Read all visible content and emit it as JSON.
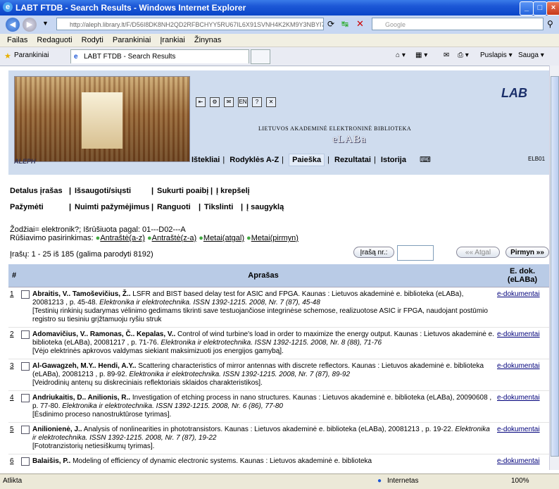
{
  "window": {
    "title": "LABT FTDB - Search Results - Windows Internet Explorer"
  },
  "address": {
    "url": "http://aleph.library.lt/F/D56I8DK8NH2QD2RFBCHYY5RU67IL6X91SVNH4K2KM9Y3NBYI7",
    "search_placeholder": "Google"
  },
  "menu": [
    "Failas",
    "Redaguoti",
    "Rodyti",
    "Parankiniai",
    "Įrankiai",
    "Žinynas"
  ],
  "tabbar": {
    "favorites": "Parankiniai",
    "tab_title": "LABT FTDB - Search Results",
    "page_label": "Puslapis",
    "safety_label": "Sauga"
  },
  "header": {
    "aleph": "ALEPH",
    "library_name": "LIETUVOS AKADEMINĖ ELEKTRONINĖ BIBLIOTEKA",
    "elaba": "eLABa",
    "logo": "LAB",
    "code": "ELB01",
    "nav": [
      "Ištekliai",
      "Rodyklės A-Z",
      "Paieška",
      "Rezultatai",
      "Istorija"
    ]
  },
  "actions": {
    "row1": [
      "Detalus įrašas",
      "Išsaugoti/siųsti",
      "Sukurti poaibį",
      "Į krepšelį"
    ],
    "row2": [
      "Pažymėti",
      "Nuimti pažymėjimus",
      "Ranguoti",
      "Tikslinti",
      "Į saugyklą"
    ]
  },
  "info": {
    "query": "Žodžiai= elektronik?; Išrūšiuota pagal: 01---D02---A",
    "sort_label": "Rūšiavimo pasirinkimas:",
    "sort_options": [
      "Antraštė(a-z)",
      "Antraštė(z-a)",
      "Metai(atgal)",
      "Metai(pirmyn)"
    ],
    "counts": "Įrašų: 1 - 25 iš 185 (galima parodyti 8192)",
    "jump_label": "Įrašą nr.:",
    "prev_label": "Atgal",
    "next_label": "Pirmyn"
  },
  "table": {
    "headers": [
      "#",
      "Aprašas",
      "E. dok. (eLABa)"
    ],
    "rows": [
      {
        "num": "1",
        "authors": "Abraitis, V..  Tamoševičius, Ž..",
        "desc": " LSFR and BIST based delay test for ASIC and FPGA.  Kaunas : Lietuvos akademinė e. biblioteka (eLABa), 20081213 , p. 45-48. ",
        "journal": "Elektronika ir elektrotechnika. ISSN 1392-1215. 2008, Nr. 7 (87), 45-48",
        "note": "[Testinių rinkinių sudarymas vėlinimo gedimams tikrinti save testuojančiose integrinėse schemose, realizuotose ASIC ir FPGA, naudojant postūmio registro su tiesiniu grįžtamuoju ryšiu struk",
        "link": "e-dokumentai"
      },
      {
        "num": "2",
        "authors": "Adomavičius, V..  Ramonas, Č..  Kepalas, V..",
        "desc": " Control of wind turbine's load in order to maximize the energy output.  Kaunas : Lietuvos akademinė e. biblioteka (eLABa), 20081217 , p. 71-76. ",
        "journal": "Elektronika ir elektrotechnika. ISSN 1392-1215. 2008, Nr. 8 (88), 71-76",
        "note": "[Vėjo elektrinės apkrovos valdymas siekiant maksimizuoti jos energijos gamybą].",
        "link": "e-dokumentai"
      },
      {
        "num": "3",
        "authors": "Al-Gawagzeh, M.Y..  Hendi, A.Y..",
        "desc": " Scattering characteristics of mirror antennas with discrete reflectors.  Kaunas : Lietuvos akademinė e. biblioteka (eLABa), 20081213 , p. 89-92. ",
        "journal": "Elektronika ir elektrotechnika. ISSN 1392-1215. 2008, Nr. 7 (87), 89-92",
        "note": "[Veidrodinių antenų su diskreciniais reflektoriais sklaidos charakteristikos].",
        "link": "e-dokumentai"
      },
      {
        "num": "4",
        "authors": "Andriukaitis, D..  Anilionis, R..",
        "desc": " Investigation of etching process in nano structures.  Kaunas : Lietuvos akademinė e. biblioteka (eLABa), 20090608 , p. 77-80. ",
        "journal": "Elektronika ir elektrotechnika. ISSN 1392-1215. 2008, Nr. 6 (86), 77-80",
        "note": "[Ėsdinimo proceso nanostruktūrose tyrimas].",
        "link": "e-dokumentai"
      },
      {
        "num": "5",
        "authors": "Anilionienė, J..",
        "desc": " Analysis of nonlinearities in phototransistors.  Kaunas : Lietuvos akademinė e. biblioteka (eLABa), 20081213 , p. 19-22. ",
        "journal": "Elektronika ir elektrotechnika. ISSN 1392-1215. 2008, Nr. 7 (87), 19-22",
        "note": "[Fototranzistorių netiesiškumų tyrimas].",
        "link": "e-dokumentai"
      },
      {
        "num": "6",
        "authors": "Balaišis, P..",
        "desc": " Modeling of efficiency of dynamic electronic systems.  Kaunas : Lietuvos akademinė e. biblioteka",
        "journal": "",
        "note": "",
        "link": "e-dokumentai"
      }
    ]
  },
  "status": {
    "left": "Atlikta",
    "zone": "Internetas",
    "zoom": "100%"
  }
}
